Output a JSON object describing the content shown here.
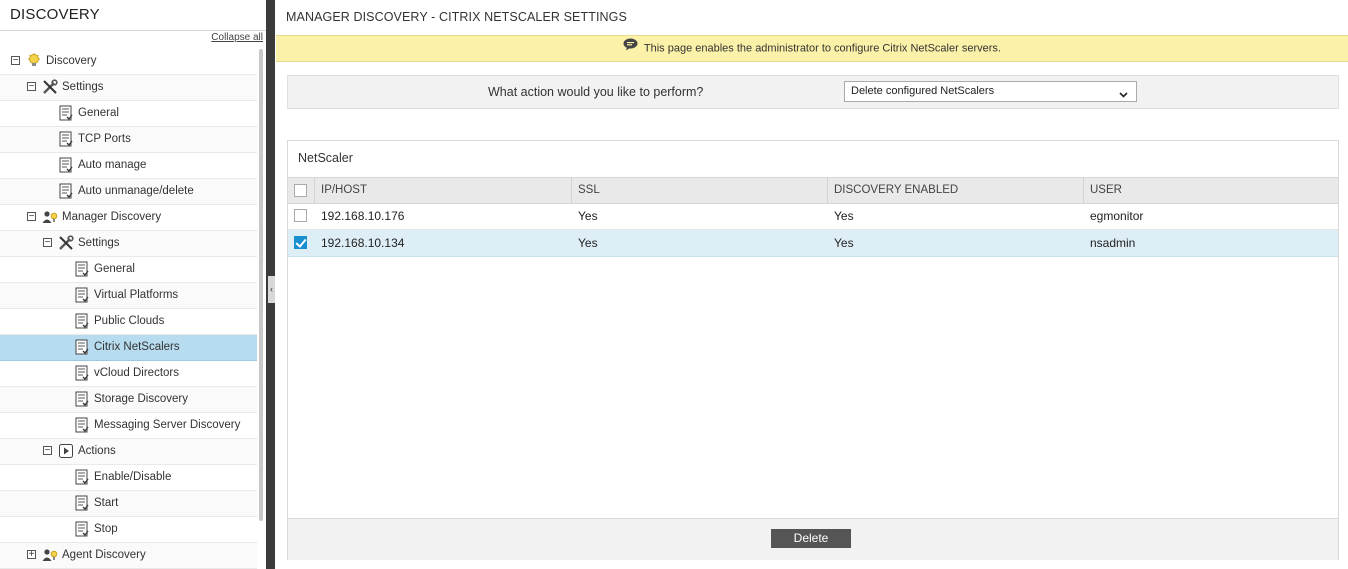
{
  "sidebar": {
    "title": "DISCOVERY",
    "collapse_all": "Collapse all",
    "items": [
      {
        "label": "Discovery",
        "level": 0,
        "toggle": "−",
        "icon": "lightbulb-icon"
      },
      {
        "label": "Settings",
        "level": 1,
        "toggle": "−",
        "icon": "tools-icon"
      },
      {
        "label": "General",
        "level": 2,
        "icon": "page-icon"
      },
      {
        "label": "TCP Ports",
        "level": 2,
        "icon": "page-icon"
      },
      {
        "label": "Auto manage",
        "level": 2,
        "icon": "page-icon"
      },
      {
        "label": "Auto unmanage/delete",
        "level": 2,
        "icon": "page-icon"
      },
      {
        "label": "Manager Discovery",
        "level": 1,
        "toggle": "−",
        "icon": "manager-icon"
      },
      {
        "label": "Settings",
        "level": 2,
        "toggle": "−",
        "icon": "tools-icon"
      },
      {
        "label": "General",
        "level": 3,
        "icon": "page-icon"
      },
      {
        "label": "Virtual Platforms",
        "level": 3,
        "icon": "page-icon"
      },
      {
        "label": "Public Clouds",
        "level": 3,
        "icon": "page-icon"
      },
      {
        "label": "Citrix NetScalers",
        "level": 3,
        "icon": "page-icon",
        "selected": true
      },
      {
        "label": "vCloud Directors",
        "level": 3,
        "icon": "page-icon"
      },
      {
        "label": "Storage Discovery",
        "level": 3,
        "icon": "page-icon"
      },
      {
        "label": "Messaging Server Discovery",
        "level": 3,
        "icon": "page-icon"
      },
      {
        "label": "Actions",
        "level": 2,
        "toggle": "−",
        "icon": "actions-icon"
      },
      {
        "label": "Enable/Disable",
        "level": 3,
        "icon": "page-icon"
      },
      {
        "label": "Start",
        "level": 3,
        "icon": "page-icon"
      },
      {
        "label": "Stop",
        "level": 3,
        "icon": "page-icon"
      },
      {
        "label": "Agent Discovery",
        "level": 1,
        "toggle": "+",
        "icon": "agent-icon"
      }
    ]
  },
  "main": {
    "title": "MANAGER DISCOVERY - CITRIX NETSCALER SETTINGS",
    "info": "This page enables the administrator to configure Citrix NetScaler servers.",
    "action_label": "What action would you like to perform?",
    "action_value": "Delete configured NetScalers",
    "grid": {
      "title": "NetScaler",
      "columns": [
        "IP/HOST",
        "SSL",
        "DISCOVERY ENABLED",
        "USER"
      ],
      "rows": [
        {
          "checked": false,
          "cells": [
            "192.168.10.176",
            "Yes",
            "Yes",
            "egmonitor"
          ]
        },
        {
          "checked": true,
          "cells": [
            "192.168.10.134",
            "Yes",
            "Yes",
            "nsadmin"
          ]
        }
      ]
    },
    "delete_label": "Delete"
  },
  "colors": {
    "info_bar": "#fbf1a9",
    "selected_row": "#b7dcef",
    "checked_row": "#deeef6",
    "checkbox_on": "#1a8fd0",
    "splitter": "#3b3b3b"
  }
}
